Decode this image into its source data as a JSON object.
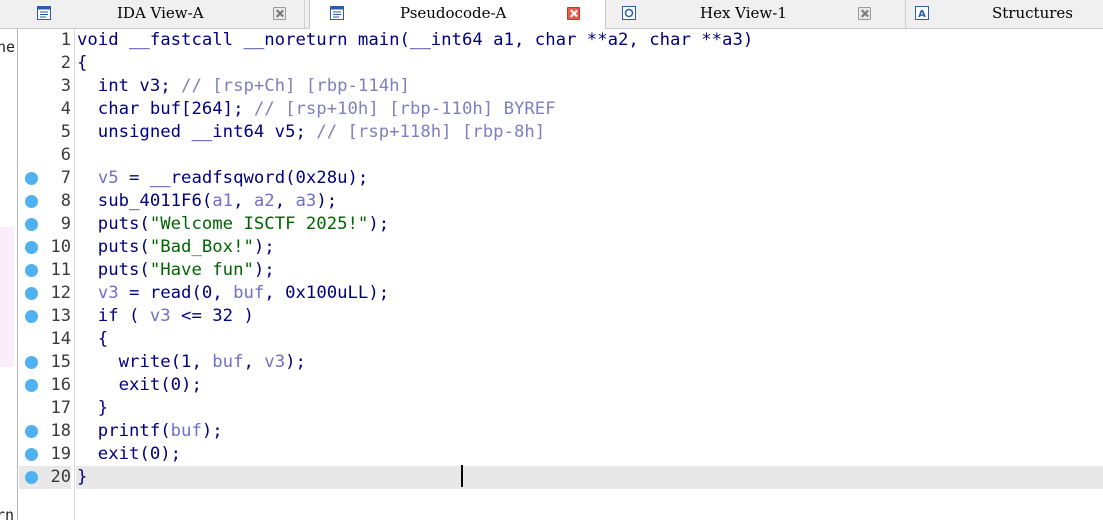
{
  "tabs": [
    {
      "label": "IDA View-A",
      "active": false,
      "close": "gray",
      "icon": "disassembly-view-icon"
    },
    {
      "label": "Pseudocode-A",
      "active": true,
      "close": "red",
      "icon": "pseudocode-view-icon"
    },
    {
      "label": "Hex View-1",
      "active": false,
      "close": "gray",
      "icon": "hex-view-icon"
    },
    {
      "label": "Structures",
      "active": false,
      "close": "none",
      "icon": "structures-icon"
    }
  ],
  "left_panel": {
    "fragment_top": "ne",
    "fragment_bottom": "rn"
  },
  "breakpoint_color": "#4fb1f0",
  "lines": [
    {
      "n": "1",
      "bp": false,
      "segments": [
        {
          "t": "void __fastcall __noreturn main(__int64 a1, char **a2, char **a3)",
          "c": "code"
        }
      ]
    },
    {
      "n": "2",
      "bp": false,
      "segments": [
        {
          "t": "{",
          "c": "code"
        }
      ]
    },
    {
      "n": "3",
      "bp": false,
      "segments": [
        {
          "t": "  int v3; ",
          "c": "code"
        },
        {
          "t": "// [rsp+Ch] [rbp-114h]",
          "c": "cmt"
        }
      ]
    },
    {
      "n": "4",
      "bp": false,
      "segments": [
        {
          "t": "  char buf[264]; ",
          "c": "code"
        },
        {
          "t": "// [rsp+10h] [rbp-110h] BYREF",
          "c": "cmt"
        }
      ]
    },
    {
      "n": "5",
      "bp": false,
      "segments": [
        {
          "t": "  unsigned __int64 v5; ",
          "c": "code"
        },
        {
          "t": "// [rsp+118h] [rbp-8h]",
          "c": "cmt"
        }
      ]
    },
    {
      "n": "6",
      "bp": false,
      "segments": [
        {
          "t": "",
          "c": "code"
        }
      ]
    },
    {
      "n": "7",
      "bp": true,
      "segments": [
        {
          "t": "  ",
          "c": "code"
        },
        {
          "t": "v5",
          "c": "var"
        },
        {
          "t": " = __readfsqword(0x28u);",
          "c": "code"
        }
      ]
    },
    {
      "n": "8",
      "bp": true,
      "segments": [
        {
          "t": "  sub_4011F6(",
          "c": "code"
        },
        {
          "t": "a1",
          "c": "var"
        },
        {
          "t": ", ",
          "c": "code"
        },
        {
          "t": "a2",
          "c": "var"
        },
        {
          "t": ", ",
          "c": "code"
        },
        {
          "t": "a3",
          "c": "var"
        },
        {
          "t": ");",
          "c": "code"
        }
      ]
    },
    {
      "n": "9",
      "bp": true,
      "segments": [
        {
          "t": "  puts(",
          "c": "code"
        },
        {
          "t": "\"Welcome ISCTF 2025!\"",
          "c": "str"
        },
        {
          "t": ");",
          "c": "code"
        }
      ]
    },
    {
      "n": "10",
      "bp": true,
      "segments": [
        {
          "t": "  puts(",
          "c": "code"
        },
        {
          "t": "\"Bad_Box!\"",
          "c": "str"
        },
        {
          "t": ");",
          "c": "code"
        }
      ]
    },
    {
      "n": "11",
      "bp": true,
      "segments": [
        {
          "t": "  puts(",
          "c": "code"
        },
        {
          "t": "\"Have fun\"",
          "c": "str"
        },
        {
          "t": ");",
          "c": "code"
        }
      ]
    },
    {
      "n": "12",
      "bp": true,
      "segments": [
        {
          "t": "  ",
          "c": "code"
        },
        {
          "t": "v3",
          "c": "var"
        },
        {
          "t": " = read(0, ",
          "c": "code"
        },
        {
          "t": "buf",
          "c": "var"
        },
        {
          "t": ", 0x100uLL);",
          "c": "code"
        }
      ]
    },
    {
      "n": "13",
      "bp": true,
      "segments": [
        {
          "t": "  if ( ",
          "c": "code"
        },
        {
          "t": "v3",
          "c": "var"
        },
        {
          "t": " <= 32 )",
          "c": "code"
        }
      ]
    },
    {
      "n": "14",
      "bp": false,
      "segments": [
        {
          "t": "  {",
          "c": "code"
        }
      ]
    },
    {
      "n": "15",
      "bp": true,
      "segments": [
        {
          "t": "    write(1, ",
          "c": "code"
        },
        {
          "t": "buf",
          "c": "var"
        },
        {
          "t": ", ",
          "c": "code"
        },
        {
          "t": "v3",
          "c": "var"
        },
        {
          "t": ");",
          "c": "code"
        }
      ]
    },
    {
      "n": "16",
      "bp": true,
      "segments": [
        {
          "t": "    exit(0);",
          "c": "code"
        }
      ]
    },
    {
      "n": "17",
      "bp": false,
      "segments": [
        {
          "t": "  }",
          "c": "code"
        }
      ]
    },
    {
      "n": "18",
      "bp": true,
      "segments": [
        {
          "t": "  printf(",
          "c": "code"
        },
        {
          "t": "buf",
          "c": "var"
        },
        {
          "t": ");",
          "c": "code"
        }
      ]
    },
    {
      "n": "19",
      "bp": true,
      "segments": [
        {
          "t": "  exit(0);",
          "c": "code"
        }
      ]
    },
    {
      "n": "20",
      "bp": true,
      "current": true,
      "segments": [
        {
          "t": "}",
          "c": "code"
        }
      ]
    }
  ]
}
